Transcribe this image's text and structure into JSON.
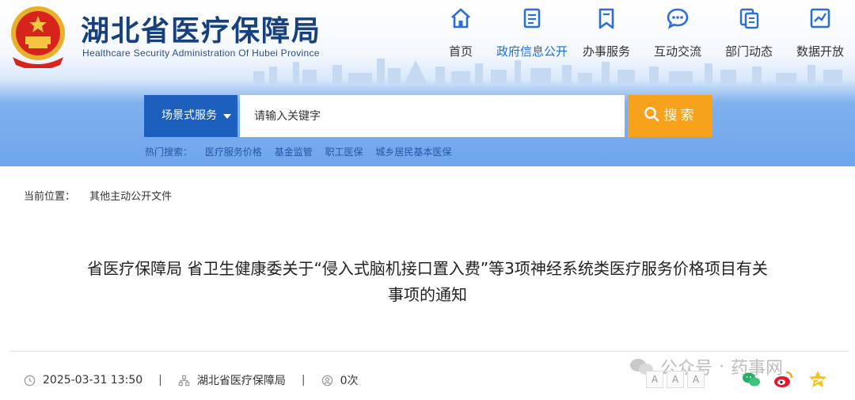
{
  "site": {
    "name": "湖北省医疗保障局",
    "english_name": "Healthcare Security Administration Of Hubei Province"
  },
  "nav": [
    {
      "label": "首页",
      "icon": "home-icon",
      "active": false
    },
    {
      "label": "政府信息公开",
      "icon": "document-icon",
      "active": true
    },
    {
      "label": "办事服务",
      "icon": "bookmark-icon",
      "active": false
    },
    {
      "label": "互动交流",
      "icon": "chat-icon",
      "active": false
    },
    {
      "label": "部门动态",
      "icon": "copy-icon",
      "active": false
    },
    {
      "label": "数据开放",
      "icon": "chart-icon",
      "active": false
    }
  ],
  "search": {
    "scene_label": "场景式服务",
    "placeholder": "请输入关键字",
    "button_label": "搜索"
  },
  "hot_search": {
    "label": "热门搜索：",
    "items": [
      "医疗服务价格",
      "基金监管",
      "职工医保",
      "城乡居民基本医保"
    ]
  },
  "breadcrumb": {
    "label": "当前位置：",
    "current": "其他主动公开文件"
  },
  "article": {
    "title_line1": "省医疗保障局 省卫生健康委关于“侵入式脑机接口置入费”等3项神经系统类医疗服务价格项目有关",
    "title_line2": "事项的通知",
    "date": "2025-03-31 13:50",
    "source": "湖北省医疗保障局",
    "views": "0次"
  },
  "font_size_options": [
    "A",
    "A",
    "A"
  ],
  "share": [
    "wechat-icon",
    "weibo-icon",
    "qzone-icon"
  ],
  "watermark": {
    "text1": "公众号",
    "dot": "·",
    "text2": "药事网"
  },
  "colors": {
    "brand_blue": "#16407f",
    "accent_blue": "#1e6fd9",
    "scene_blue": "#1c5fbd",
    "search_orange": "#f7a21c"
  }
}
